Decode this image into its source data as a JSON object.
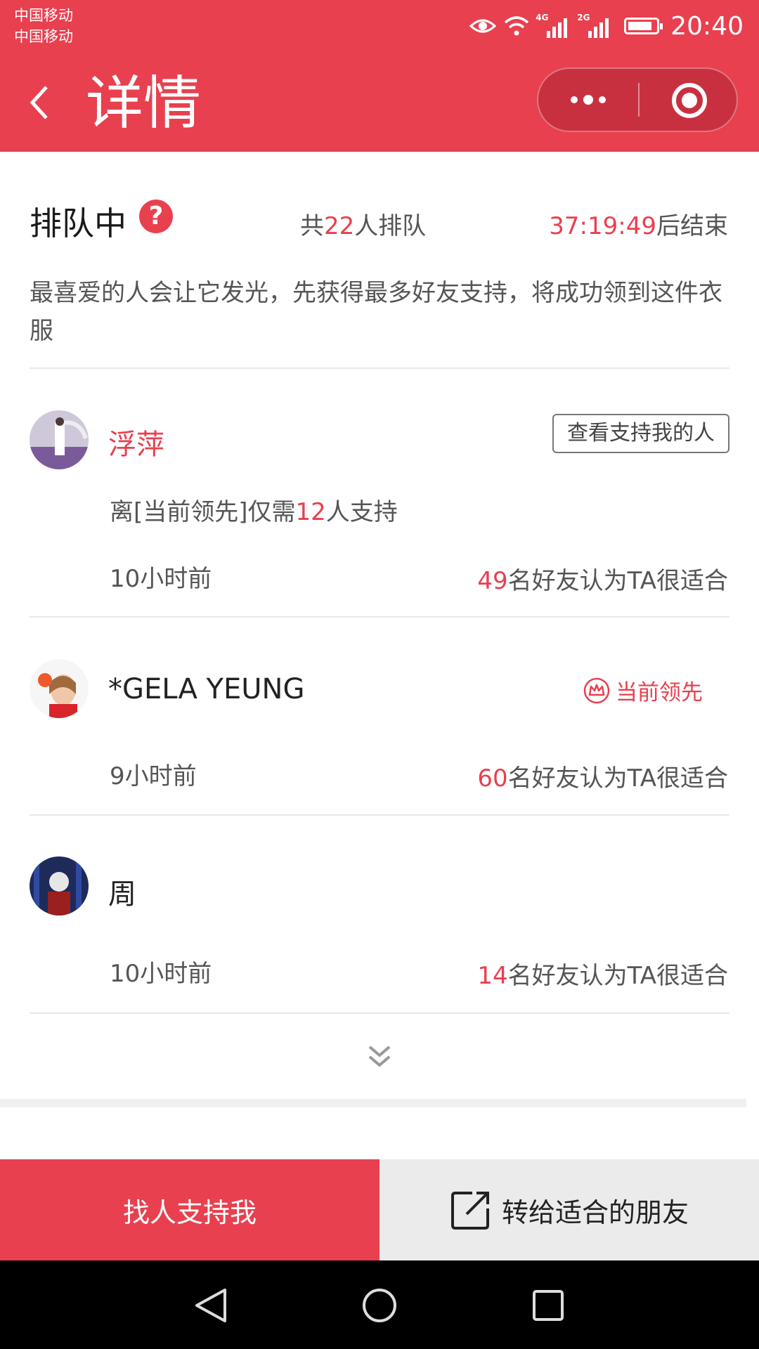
{
  "status_bar": {
    "carrier_1": "中国移动",
    "carrier_2": "中国移动",
    "network_1": "4G",
    "network_2": "2G",
    "time": "20:40"
  },
  "header": {
    "title": "详情",
    "back_icon": "chevron-left-icon",
    "more_icon": "more-dots-icon",
    "close_icon": "target-close-icon"
  },
  "queue": {
    "status": "排队中",
    "help_icon": "?",
    "count_prefix": "共",
    "count": "22",
    "count_suffix": "人排队",
    "countdown": "37:19:49",
    "countdown_suffix": "后结束",
    "description": "最喜爱的人会让它发光，先获得最多好友支持，将成功领到这件衣服"
  },
  "entries": [
    {
      "name": "浮萍",
      "view_button": "查看支持我的人",
      "gap_prefix": "离[当前领先]仅需",
      "gap_number": "12",
      "gap_suffix": "人支持",
      "time_ago": "10小时前",
      "votes": "49",
      "votes_suffix": "名好友认为TA很适合"
    },
    {
      "name": "*GELA YEUNG",
      "leader_label": "当前领先",
      "time_ago": "9小时前",
      "votes": "60",
      "votes_suffix": "名好友认为TA很适合"
    },
    {
      "name": "周",
      "time_ago": "10小时前",
      "votes": "14",
      "votes_suffix": "名好友认为TA很适合"
    }
  ],
  "bottom_bar": {
    "support_button": "找人支持我",
    "forward_button": "转给适合的朋友"
  },
  "colors": {
    "accent": "#e8404f",
    "text_dark": "#222222",
    "text_gray": "#555555"
  }
}
